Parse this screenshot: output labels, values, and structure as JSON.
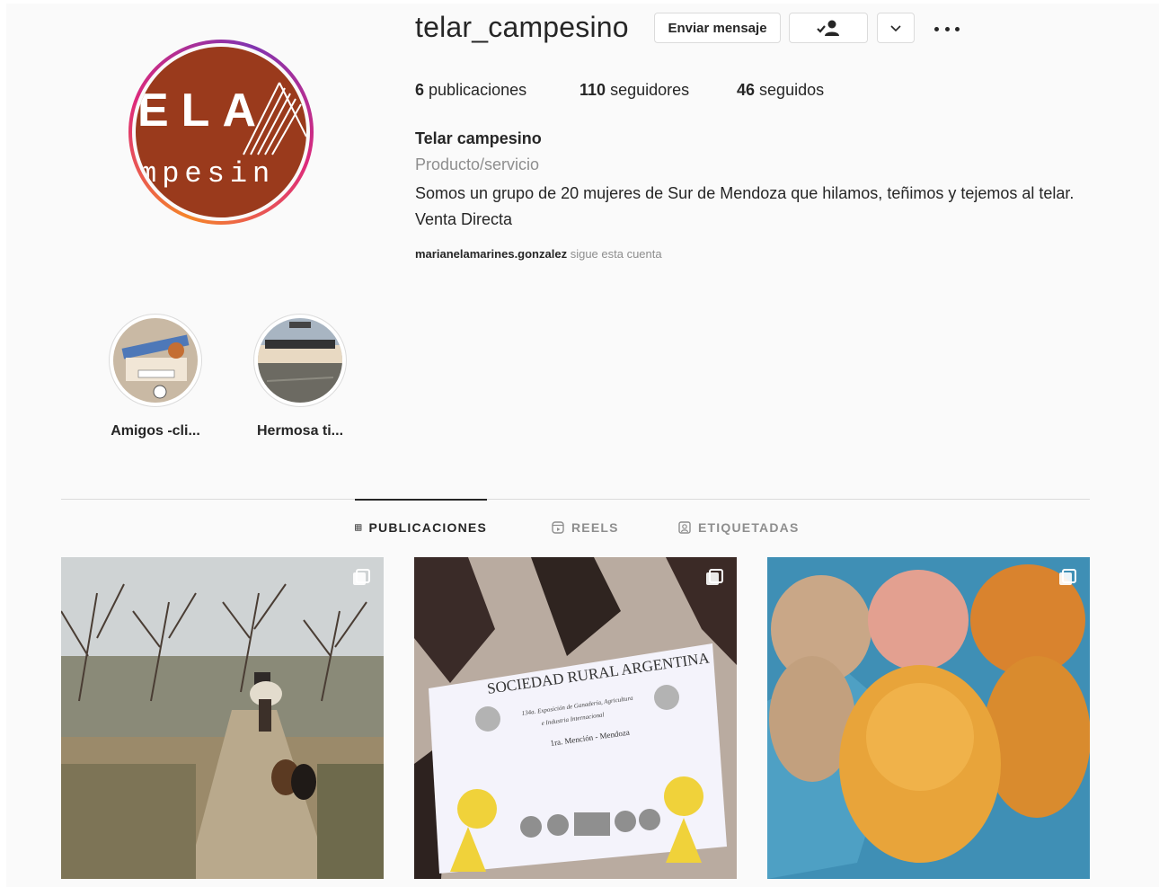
{
  "profile": {
    "username": "telar_campesino",
    "avatar_text_top": "ELA",
    "avatar_text_bottom": "mpesin",
    "message_button": "Enviar mensaje",
    "follow_icon": "person-check-icon",
    "dropdown_icon": "chevron-down-icon",
    "more_icon": "more-options-icon"
  },
  "stats": {
    "posts_count": "6",
    "posts_label": "publicaciones",
    "followers_count": "110",
    "followers_label": "seguidores",
    "following_count": "46",
    "following_label": "seguidos"
  },
  "bio": {
    "name": "Telar campesino",
    "category": "Producto/servicio",
    "text": "Somos un grupo de 20 mujeres de Sur de Mendoza que hilamos, teñimos y tejemos al telar. Venta Directa",
    "followed_by_user": "marianelamarines.gonzalez",
    "followed_by_suffix": "sigue esta cuenta"
  },
  "highlights": [
    {
      "label": "Amigos -cli..."
    },
    {
      "label": "Hermosa ti..."
    }
  ],
  "tabs": [
    {
      "label": "PUBLICACIONES",
      "icon": "grid-icon",
      "active": true
    },
    {
      "label": "REELS",
      "icon": "reels-icon",
      "active": false
    },
    {
      "label": "ETIQUETADAS",
      "icon": "tagged-icon",
      "active": false
    }
  ],
  "posts": [
    {
      "subject": "rider-with-dogs-on-dirt-road",
      "multi": true
    },
    {
      "subject": "certificate",
      "multi": true,
      "certificate_title": "SOCIEDAD RURAL ARGENTINA",
      "certificate_line_1": "134a. Exposición de Ganadería, Agricultura",
      "certificate_line_2": "e Industria Internacional",
      "certificate_line_3": "1ra. Mención - Mendoza"
    },
    {
      "subject": "dyed-wool-skeins",
      "multi": true
    }
  ],
  "colors": {
    "avatar_bg": "#9a3a1c",
    "ring_start": "#f58529",
    "ring_mid": "#dd2a7b",
    "text_primary": "#262626",
    "text_secondary": "#8e8e8e",
    "border": "#dbdbdb"
  }
}
